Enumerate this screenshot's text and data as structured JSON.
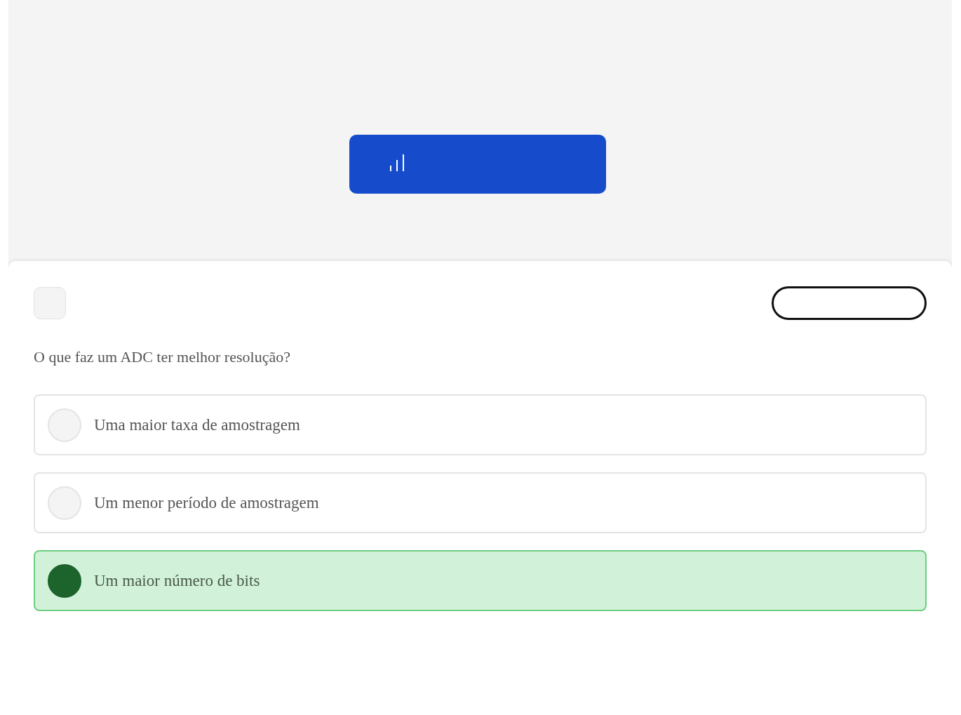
{
  "question": "O que faz um ADC ter melhor resolução?",
  "options": [
    {
      "label": "Uma maior taxa de amostragem",
      "selected": false
    },
    {
      "label": "Um menor período de amostragem",
      "selected": false
    },
    {
      "label": "Um maior número de bits",
      "selected": true
    }
  ]
}
